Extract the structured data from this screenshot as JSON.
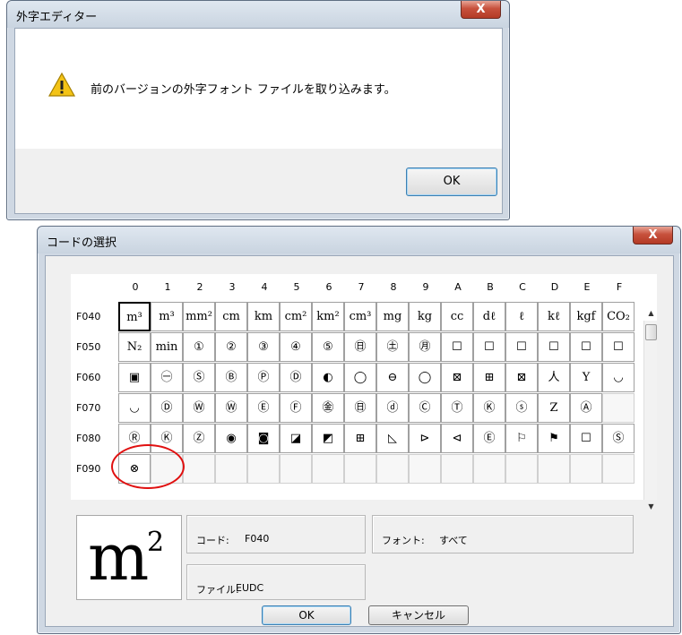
{
  "message_box": {
    "title": "外字エディター",
    "close_label": "X",
    "message": "前のバージョンの外字フォント ファイルを取り込みます。",
    "ok_label": "OK"
  },
  "code_select": {
    "title": "コードの選択",
    "close_label": "X",
    "columns": [
      "0",
      "1",
      "2",
      "3",
      "4",
      "5",
      "6",
      "7",
      "8",
      "9",
      "A",
      "B",
      "C",
      "D",
      "E",
      "F"
    ],
    "rows": [
      {
        "code": "F040",
        "cells": [
          "m³",
          "m³",
          "mm²",
          "cm",
          "km",
          "cm²",
          "km²",
          "cm³",
          "mg",
          "kg",
          "cc",
          "dℓ",
          "ℓ",
          "kℓ",
          "kgf",
          "CO₂"
        ]
      },
      {
        "code": "F050",
        "cells": [
          "N₂",
          "min",
          "①",
          "②",
          "③",
          "④",
          "⑤",
          "㊐",
          "㊏",
          "㊊",
          "☐",
          "☐",
          "☐",
          "☐",
          "☐",
          "☐"
        ]
      },
      {
        "code": "F060",
        "cells": [
          "▣",
          "㊀",
          "Ⓢ",
          "Ⓑ",
          "Ⓟ",
          "Ⓓ",
          "◐",
          "◯",
          "⊖",
          "◯",
          "⊠",
          "⊞",
          "⊠",
          "人",
          "Y",
          "◡"
        ]
      },
      {
        "code": "F070",
        "cells": [
          "◡",
          "Ⓓ",
          "Ⓦ",
          "Ⓦ",
          "Ⓔ",
          "Ⓕ",
          "㊎",
          "㊐",
          "ⓓ",
          "Ⓒ",
          "Ⓣ",
          "Ⓚ",
          "ⓢ",
          "Z",
          "Ⓐ",
          ""
        ]
      },
      {
        "code": "F080",
        "cells": [
          "Ⓡ",
          "Ⓚ",
          "Ⓩ",
          "◉",
          "◙",
          "◪",
          "◩",
          "⊞",
          "◺",
          "⊳",
          "⊲",
          "Ⓔ",
          "⚐",
          "⚑",
          "☐",
          "Ⓢ"
        ]
      },
      {
        "code": "F090",
        "cells": [
          "⊗",
          "",
          "",
          "",
          "",
          "",
          "",
          "",
          "",
          "",
          "",
          "",
          "",
          "",
          "",
          ""
        ]
      }
    ],
    "preview_glyph": "m",
    "preview_sup": "2",
    "code_label": "コード:",
    "code_value": "F040",
    "font_label": "フォント:",
    "font_value": "すべて",
    "file_label": "ファイル:",
    "file_value": "EUDC",
    "ok_label": "OK",
    "cancel_label": "キャンセル"
  },
  "colors": {
    "accent": "#3c7fb1",
    "close_button": "#c7513c",
    "highlight_circle": "#e01010"
  }
}
